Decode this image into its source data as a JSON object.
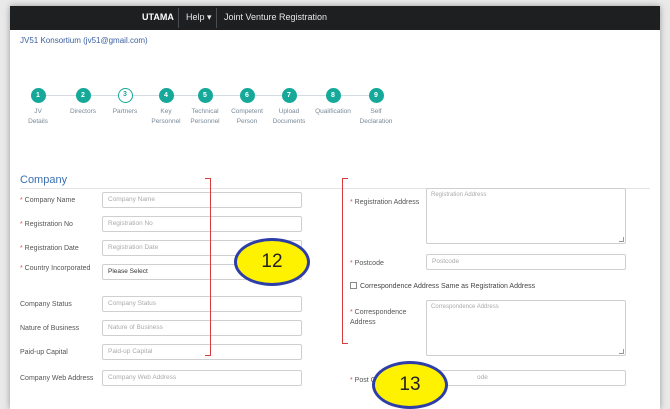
{
  "topbar": {
    "brand": "UTAMA",
    "help": "Help ▾",
    "breadcrumb": "Joint Venture Registration"
  },
  "account": "JV51 Konsortium (jv51@gmail.com)",
  "steps": [
    {
      "num": "1",
      "label": "JV\nDetails",
      "state": "done"
    },
    {
      "num": "2",
      "label": "Directors",
      "state": "done"
    },
    {
      "num": "3",
      "label": "Partners",
      "state": "current"
    },
    {
      "num": "4",
      "label": "Key\nPersonnel",
      "state": "done"
    },
    {
      "num": "5",
      "label": "Technical\nPersonnel",
      "state": "done"
    },
    {
      "num": "6",
      "label": "Competent\nPerson",
      "state": "done"
    },
    {
      "num": "7",
      "label": "Upload\nDocuments",
      "state": "done"
    },
    {
      "num": "8",
      "label": "Qualification",
      "state": "done"
    },
    {
      "num": "9",
      "label": "Self\nDeclaration",
      "state": "done"
    }
  ],
  "section_title": "Company",
  "left_fields": [
    {
      "label": "Company Name",
      "required": true,
      "placeholder": "Company Name"
    },
    {
      "label": "Registration No",
      "required": true,
      "placeholder": "Registration No"
    },
    {
      "label": "Registration Date",
      "required": true,
      "placeholder": "Registration Date"
    },
    {
      "label": "Country Incorporated",
      "required": true,
      "value": "Please Select"
    },
    {
      "label": "Company Status",
      "required": false,
      "placeholder": "Company Status"
    },
    {
      "label": "Nature of Business",
      "required": false,
      "placeholder": "Nature of Business"
    },
    {
      "label": "Paid-up Capital",
      "required": false,
      "placeholder": "Paid-up Capital"
    },
    {
      "label": "Company Web Address",
      "required": false,
      "placeholder": "Company Web Address"
    }
  ],
  "right_fields": {
    "registration_address": {
      "label": "Registration Address",
      "placeholder": "Registration Address"
    },
    "postcode": {
      "label": "Postcode",
      "placeholder": "Postcode"
    },
    "same_address_checkbox": "Correspondence Address Same as Registration Address",
    "correspondence_address": {
      "label": "Correspondence Address",
      "placeholder": "Correspondence Address"
    },
    "post_code": {
      "label": "Post C",
      "placeholder": "ode"
    }
  },
  "callouts": {
    "a": "12",
    "b": "13"
  },
  "colors": {
    "accent": "#16a99a",
    "link": "#3a6fb0",
    "annotation_red": "#d63c3c",
    "callout_fill": "#fff200",
    "callout_border": "#2e3ea8"
  }
}
